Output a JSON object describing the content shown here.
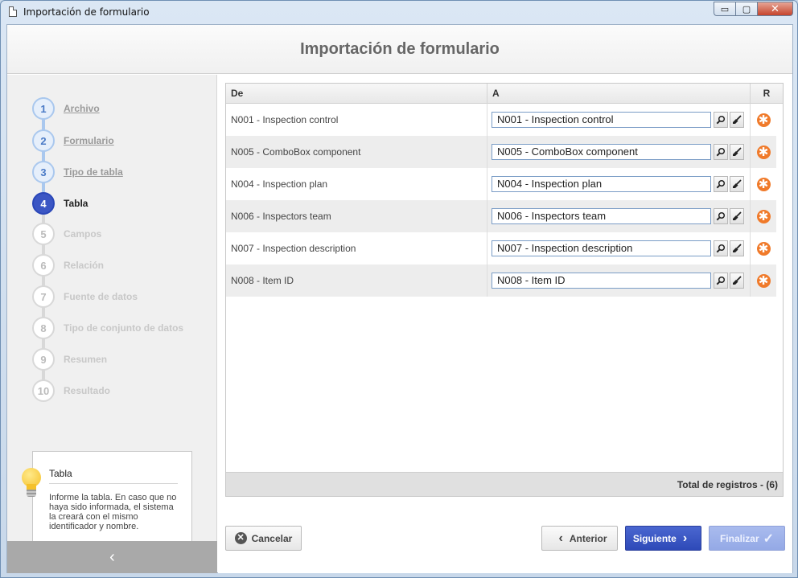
{
  "window": {
    "title": "Importación de formulario",
    "minimize": "▭",
    "maximize": "▢",
    "close": "✕"
  },
  "header": {
    "title": "Importación de formulario"
  },
  "steps": [
    {
      "num": "1",
      "label": "Archivo",
      "state": "done"
    },
    {
      "num": "2",
      "label": "Formulario",
      "state": "done"
    },
    {
      "num": "3",
      "label": "Tipo de tabla",
      "state": "done"
    },
    {
      "num": "4",
      "label": "Tabla",
      "state": "active"
    },
    {
      "num": "5",
      "label": "Campos",
      "state": "pending"
    },
    {
      "num": "6",
      "label": "Relación",
      "state": "pending"
    },
    {
      "num": "7",
      "label": "Fuente de datos",
      "state": "pending"
    },
    {
      "num": "8",
      "label": "Tipo de conjunto de datos",
      "state": "pending"
    },
    {
      "num": "9",
      "label": "Resumen",
      "state": "pending"
    },
    {
      "num": "10",
      "label": "Resultado",
      "state": "pending"
    }
  ],
  "hint": {
    "title": "Tabla",
    "text": "Informe la tabla. En caso que no haya sido informada, el sistema la creará con el mismo identificador y nombre."
  },
  "sidebar": {
    "collapse_glyph": "‹"
  },
  "grid": {
    "columns": {
      "de": "De",
      "a": "A",
      "r": "R"
    },
    "rows": [
      {
        "de": "N001 - Inspection control",
        "a": "N001 - Inspection control"
      },
      {
        "de": "N005 - ComboBox component",
        "a": "N005 - ComboBox component"
      },
      {
        "de": "N004 - Inspection plan",
        "a": "N004 - Inspection plan"
      },
      {
        "de": "N006 - Inspectors team",
        "a": "N006 - Inspectors team"
      },
      {
        "de": "N007 - Inspection description",
        "a": "N007 - Inspection description"
      },
      {
        "de": "N008 - Item ID",
        "a": "N008 - Item ID"
      }
    ],
    "footer": "Total de registros  - (6)",
    "required_glyph": "✱"
  },
  "buttons": {
    "cancel": "Cancelar",
    "prev": "Anterior",
    "next": "Siguiente",
    "finish": "Finalizar"
  }
}
